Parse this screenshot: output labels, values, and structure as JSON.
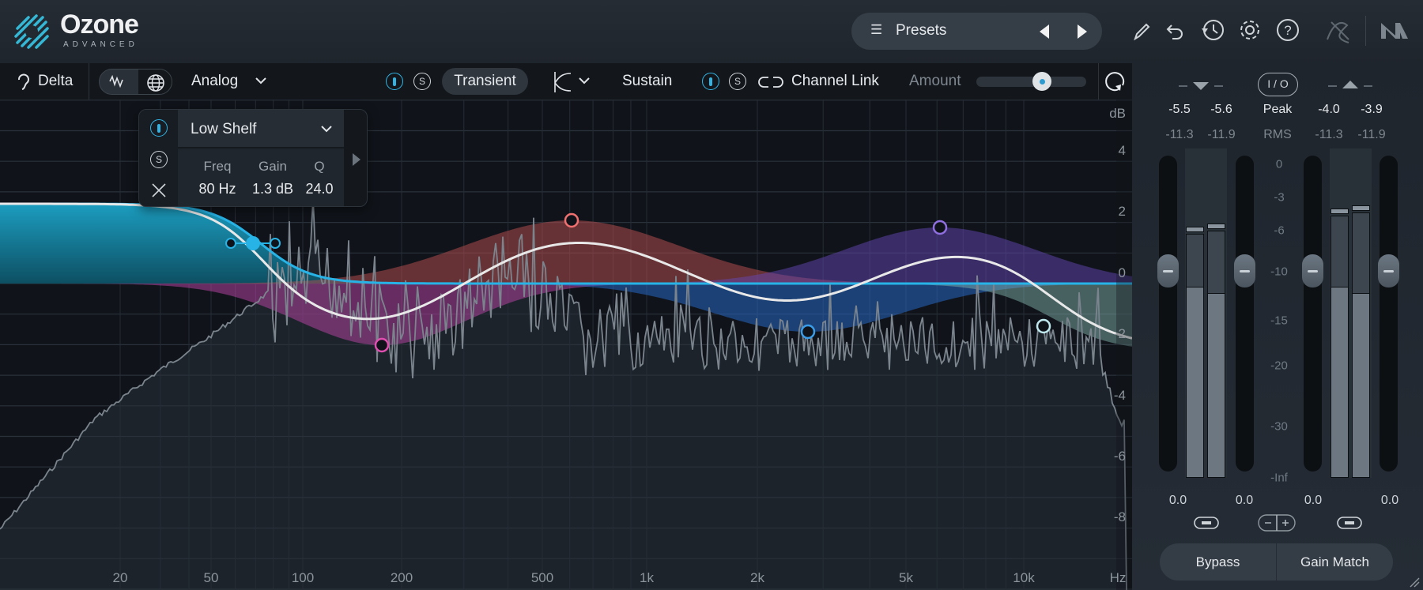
{
  "app": {
    "name": "Ozone",
    "edition": "ADVANCED"
  },
  "header": {
    "presets_label": "Presets",
    "icons": [
      "list-icon",
      "prev-preset-icon",
      "next-preset-icon",
      "pencil-icon",
      "undo-icon",
      "history-icon",
      "gear-icon",
      "help-icon",
      "signature-icon",
      "ni-logo"
    ]
  },
  "toolbar": {
    "delta": "Delta",
    "mode": "Analog",
    "transient": "Transient",
    "sustain": "Sustain",
    "solo": "S",
    "channel_link": "Channel Link",
    "amount": "Amount",
    "amount_value": 0.6
  },
  "popup": {
    "type": "Low Shelf",
    "freq_label": "Freq",
    "gain_label": "Gain",
    "q_label": "Q",
    "freq": "80 Hz",
    "gain": "1.3 dB",
    "q": "24.0",
    "solo": "S"
  },
  "graph": {
    "db_unit": "dB",
    "db_labels": [
      "4",
      "2",
      "0",
      "-2",
      "-4",
      "-6",
      "-8"
    ],
    "freq_labels": [
      "20",
      "50",
      "100",
      "200",
      "500",
      "1k",
      "2k",
      "5k",
      "10k"
    ],
    "freq_unit": "Hz",
    "colors": {
      "shelf": "#27b3e6",
      "curve": "#e8e8e8",
      "pink": "#e04fb0",
      "red": "#f07070",
      "blue": "#3a9ce8",
      "purple": "#8f6fe0",
      "light": "#bfe8ef"
    }
  },
  "meters": {
    "io": "I / O",
    "peak_label": "Peak",
    "rms_label": "RMS",
    "in_peak": [
      "-5.5",
      "-5.6"
    ],
    "out_peak": [
      "-4.0",
      "-3.9"
    ],
    "in_rms": [
      "-11.3",
      "-11.9"
    ],
    "out_rms": [
      "-11.3",
      "-11.9"
    ],
    "scale": [
      "0",
      "-3",
      "-6",
      "-10",
      "-15",
      "-20",
      "-30",
      "-Inf"
    ],
    "gains": [
      "0.0",
      "0.0",
      "0.0",
      "0.0"
    ]
  },
  "footer": {
    "bypass": "Bypass",
    "gain_match": "Gain Match"
  }
}
